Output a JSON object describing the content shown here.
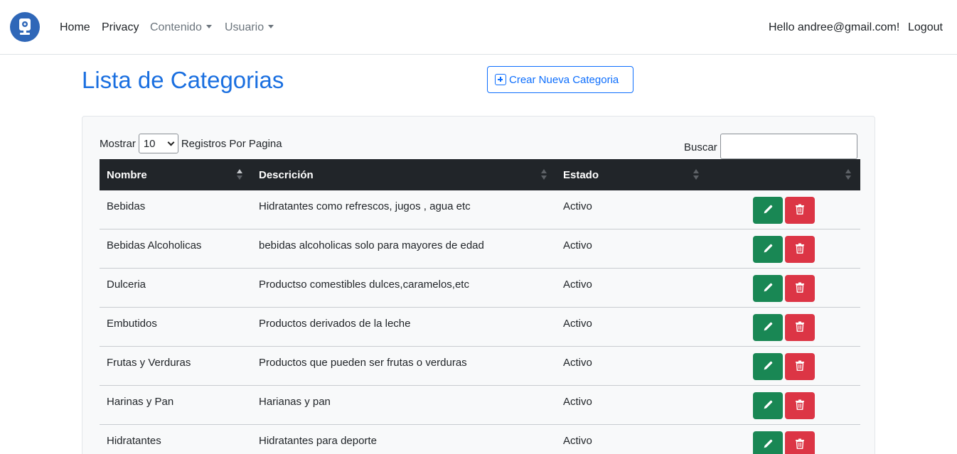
{
  "nav": {
    "home": "Home",
    "privacy": "Privacy",
    "contenido": "Contenido",
    "usuario": "Usuario",
    "greeting": "Hello andree@gmail.com!",
    "logout": "Logout"
  },
  "page": {
    "title": "Lista de Categorias",
    "create_button": "Crear Nueva Categoria"
  },
  "table_controls": {
    "show_prefix": "Mostrar",
    "page_size": "10",
    "show_suffix": "Registros Por Pagina",
    "search_label": "Buscar",
    "search_value": ""
  },
  "table": {
    "columns": [
      "Nombre",
      "Descrición",
      "Estado",
      ""
    ],
    "rows": [
      {
        "nombre": "Bebidas",
        "descripcion": "Hidratantes como refrescos, jugos , agua etc",
        "estado": "Activo"
      },
      {
        "nombre": "Bebidas Alcoholicas",
        "descripcion": "bebidas alcoholicas solo para mayores de edad",
        "estado": "Activo"
      },
      {
        "nombre": "Dulceria",
        "descripcion": "Productso comestibles dulces,caramelos,etc",
        "estado": "Activo"
      },
      {
        "nombre": "Embutidos",
        "descripcion": "Productos derivados de la leche",
        "estado": "Activo"
      },
      {
        "nombre": "Frutas y Verduras",
        "descripcion": "Productos que pueden ser frutas o verduras",
        "estado": "Activo"
      },
      {
        "nombre": "Harinas y Pan",
        "descripcion": "Harianas y pan",
        "estado": "Activo"
      },
      {
        "nombre": "Hidratantes",
        "descripcion": "Hidratantes para deporte",
        "estado": "Activo"
      }
    ]
  },
  "colors": {
    "primary": "#0d6efd",
    "title": "#1a6fe0",
    "edit": "#198754",
    "delete": "#dc3545",
    "table_header": "#212529"
  }
}
